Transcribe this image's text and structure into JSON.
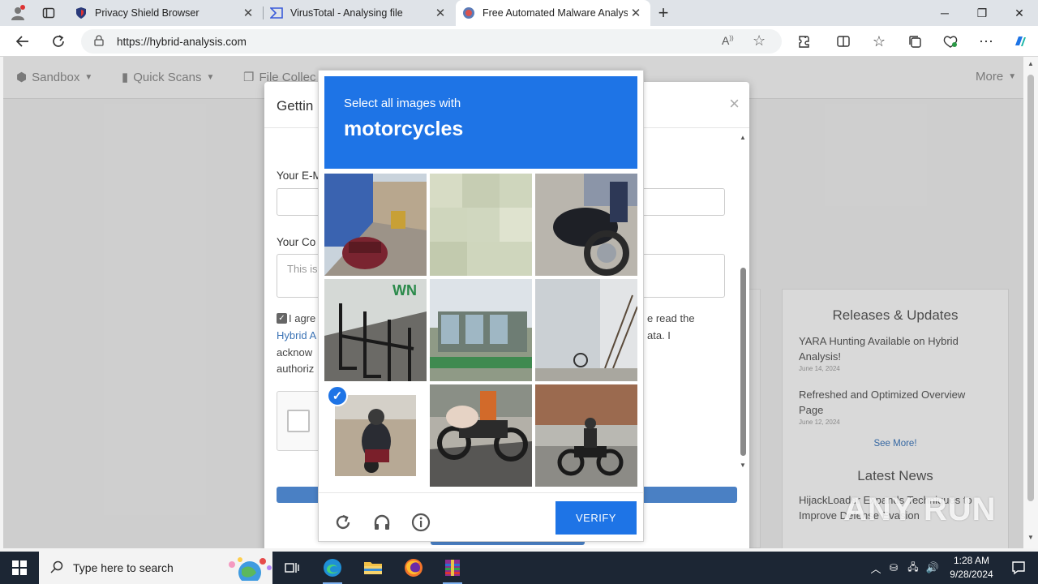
{
  "browser": {
    "tabs": [
      {
        "title": "Privacy Shield Browser",
        "icon": "shield-icon"
      },
      {
        "title": "VirusTotal - Analysing file",
        "icon": "virustotal-icon"
      },
      {
        "title": "Free Automated Malware Analysi",
        "icon": "hybrid-analysis-icon",
        "active": true
      }
    ],
    "url": "https://hybrid-analysis.com"
  },
  "page": {
    "nav": [
      "Sandbox",
      "Quick Scans",
      "File Collec",
      "More"
    ],
    "modal": {
      "title": "Gettin",
      "email_label": "Your E-M",
      "comment_label": "Your Co",
      "comment_placeholder": "This is",
      "agree_lines": [
        "I agre",
        "Hybrid A",
        "acknow",
        "authoriz"
      ],
      "agree_right": [
        "e read the",
        "ata. I"
      ]
    },
    "releases": {
      "heading": "Releases & Updates",
      "items": [
        {
          "title": "YARA Hunting Available on Hybrid Analysis!",
          "date": "June 14, 2024"
        },
        {
          "title": "Refreshed and Optimized Overview Page",
          "date": "June 12, 2024"
        }
      ],
      "see_more": "See More!",
      "latest_news": "Latest News",
      "news_item": "HijackLoader Expands Techniques to Improve Defense Evasion"
    }
  },
  "captcha": {
    "prompt": "Select all images with",
    "target": "motorcycles",
    "verify_label": "VERIFY",
    "selected_tiles": [
      7
    ]
  },
  "watermark": "ANY RUN",
  "taskbar": {
    "search_placeholder": "Type here to search",
    "time": "1:28 AM",
    "date": "9/28/2024"
  }
}
